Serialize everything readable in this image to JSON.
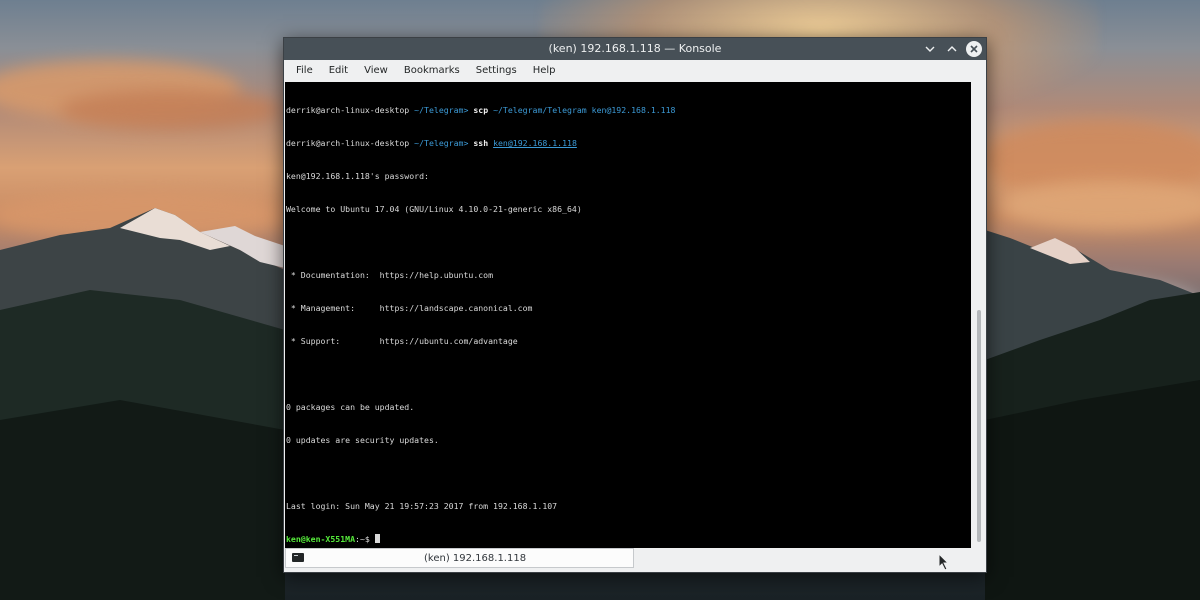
{
  "window": {
    "title": "(ken) 192.168.1.118 — Konsole"
  },
  "menubar": {
    "items": [
      "File",
      "Edit",
      "View",
      "Bookmarks",
      "Settings",
      "Help"
    ]
  },
  "terminal": {
    "line1": {
      "host": "derrik@arch-linux-desktop",
      "path": "~/Telegram>",
      "cmd": "scp",
      "args": "~/Telegram/Telegram ken@192.168.1.118"
    },
    "line2": {
      "host": "derrik@arch-linux-desktop",
      "path": "~/Telegram>",
      "cmd": "ssh",
      "args": "ken@192.168.1.118"
    },
    "line3": "ken@192.168.1.118's password:",
    "line4": "Welcome to Ubuntu 17.04 (GNU/Linux 4.10.0-21-generic x86_64)",
    "line5": "",
    "line6": " * Documentation:  https://help.ubuntu.com",
    "line7": " * Management:     https://landscape.canonical.com",
    "line8": " * Support:        https://ubuntu.com/advantage",
    "line9": "",
    "line10": "0 packages can be updated.",
    "line11": "0 updates are security updates.",
    "line12": "",
    "line13": "Last login: Sun May 21 19:57:23 2017 from 192.168.1.107",
    "prompt": {
      "user": "ken@ken-X551MA",
      "rest": ":~$ "
    }
  },
  "tabbar": {
    "tab_label": "(ken) 192.168.1.118"
  },
  "icons": {
    "window_buttons": [
      "chevron-down-icon",
      "chevron-up-icon",
      "close-icon"
    ],
    "tab": "terminal-icon"
  },
  "colors": {
    "titlebar": "#475057",
    "terminal_bg": "#000000",
    "prompt_green": "#55e83a",
    "path_blue": "#3c9ad6"
  }
}
